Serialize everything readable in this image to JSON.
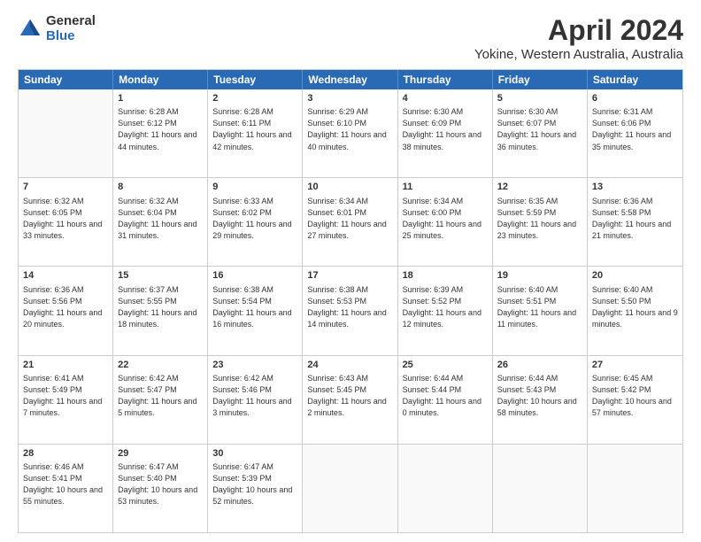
{
  "logo": {
    "general": "General",
    "blue": "Blue"
  },
  "title": "April 2024",
  "subtitle": "Yokine, Western Australia, Australia",
  "calendar": {
    "headers": [
      "Sunday",
      "Monday",
      "Tuesday",
      "Wednesday",
      "Thursday",
      "Friday",
      "Saturday"
    ],
    "weeks": [
      [
        {
          "day": "",
          "sunrise": "",
          "sunset": "",
          "daylight": "",
          "empty": true
        },
        {
          "day": "1",
          "sunrise": "Sunrise: 6:28 AM",
          "sunset": "Sunset: 6:12 PM",
          "daylight": "Daylight: 11 hours and 44 minutes."
        },
        {
          "day": "2",
          "sunrise": "Sunrise: 6:28 AM",
          "sunset": "Sunset: 6:11 PM",
          "daylight": "Daylight: 11 hours and 42 minutes."
        },
        {
          "day": "3",
          "sunrise": "Sunrise: 6:29 AM",
          "sunset": "Sunset: 6:10 PM",
          "daylight": "Daylight: 11 hours and 40 minutes."
        },
        {
          "day": "4",
          "sunrise": "Sunrise: 6:30 AM",
          "sunset": "Sunset: 6:09 PM",
          "daylight": "Daylight: 11 hours and 38 minutes."
        },
        {
          "day": "5",
          "sunrise": "Sunrise: 6:30 AM",
          "sunset": "Sunset: 6:07 PM",
          "daylight": "Daylight: 11 hours and 36 minutes."
        },
        {
          "day": "6",
          "sunrise": "Sunrise: 6:31 AM",
          "sunset": "Sunset: 6:06 PM",
          "daylight": "Daylight: 11 hours and 35 minutes."
        }
      ],
      [
        {
          "day": "7",
          "sunrise": "Sunrise: 6:32 AM",
          "sunset": "Sunset: 6:05 PM",
          "daylight": "Daylight: 11 hours and 33 minutes."
        },
        {
          "day": "8",
          "sunrise": "Sunrise: 6:32 AM",
          "sunset": "Sunset: 6:04 PM",
          "daylight": "Daylight: 11 hours and 31 minutes."
        },
        {
          "day": "9",
          "sunrise": "Sunrise: 6:33 AM",
          "sunset": "Sunset: 6:02 PM",
          "daylight": "Daylight: 11 hours and 29 minutes."
        },
        {
          "day": "10",
          "sunrise": "Sunrise: 6:34 AM",
          "sunset": "Sunset: 6:01 PM",
          "daylight": "Daylight: 11 hours and 27 minutes."
        },
        {
          "day": "11",
          "sunrise": "Sunrise: 6:34 AM",
          "sunset": "Sunset: 6:00 PM",
          "daylight": "Daylight: 11 hours and 25 minutes."
        },
        {
          "day": "12",
          "sunrise": "Sunrise: 6:35 AM",
          "sunset": "Sunset: 5:59 PM",
          "daylight": "Daylight: 11 hours and 23 minutes."
        },
        {
          "day": "13",
          "sunrise": "Sunrise: 6:36 AM",
          "sunset": "Sunset: 5:58 PM",
          "daylight": "Daylight: 11 hours and 21 minutes."
        }
      ],
      [
        {
          "day": "14",
          "sunrise": "Sunrise: 6:36 AM",
          "sunset": "Sunset: 5:56 PM",
          "daylight": "Daylight: 11 hours and 20 minutes."
        },
        {
          "day": "15",
          "sunrise": "Sunrise: 6:37 AM",
          "sunset": "Sunset: 5:55 PM",
          "daylight": "Daylight: 11 hours and 18 minutes."
        },
        {
          "day": "16",
          "sunrise": "Sunrise: 6:38 AM",
          "sunset": "Sunset: 5:54 PM",
          "daylight": "Daylight: 11 hours and 16 minutes."
        },
        {
          "day": "17",
          "sunrise": "Sunrise: 6:38 AM",
          "sunset": "Sunset: 5:53 PM",
          "daylight": "Daylight: 11 hours and 14 minutes."
        },
        {
          "day": "18",
          "sunrise": "Sunrise: 6:39 AM",
          "sunset": "Sunset: 5:52 PM",
          "daylight": "Daylight: 11 hours and 12 minutes."
        },
        {
          "day": "19",
          "sunrise": "Sunrise: 6:40 AM",
          "sunset": "Sunset: 5:51 PM",
          "daylight": "Daylight: 11 hours and 11 minutes."
        },
        {
          "day": "20",
          "sunrise": "Sunrise: 6:40 AM",
          "sunset": "Sunset: 5:50 PM",
          "daylight": "Daylight: 11 hours and 9 minutes."
        }
      ],
      [
        {
          "day": "21",
          "sunrise": "Sunrise: 6:41 AM",
          "sunset": "Sunset: 5:49 PM",
          "daylight": "Daylight: 11 hours and 7 minutes."
        },
        {
          "day": "22",
          "sunrise": "Sunrise: 6:42 AM",
          "sunset": "Sunset: 5:47 PM",
          "daylight": "Daylight: 11 hours and 5 minutes."
        },
        {
          "day": "23",
          "sunrise": "Sunrise: 6:42 AM",
          "sunset": "Sunset: 5:46 PM",
          "daylight": "Daylight: 11 hours and 3 minutes."
        },
        {
          "day": "24",
          "sunrise": "Sunrise: 6:43 AM",
          "sunset": "Sunset: 5:45 PM",
          "daylight": "Daylight: 11 hours and 2 minutes."
        },
        {
          "day": "25",
          "sunrise": "Sunrise: 6:44 AM",
          "sunset": "Sunset: 5:44 PM",
          "daylight": "Daylight: 11 hours and 0 minutes."
        },
        {
          "day": "26",
          "sunrise": "Sunrise: 6:44 AM",
          "sunset": "Sunset: 5:43 PM",
          "daylight": "Daylight: 10 hours and 58 minutes."
        },
        {
          "day": "27",
          "sunrise": "Sunrise: 6:45 AM",
          "sunset": "Sunset: 5:42 PM",
          "daylight": "Daylight: 10 hours and 57 minutes."
        }
      ],
      [
        {
          "day": "28",
          "sunrise": "Sunrise: 6:46 AM",
          "sunset": "Sunset: 5:41 PM",
          "daylight": "Daylight: 10 hours and 55 minutes."
        },
        {
          "day": "29",
          "sunrise": "Sunrise: 6:47 AM",
          "sunset": "Sunset: 5:40 PM",
          "daylight": "Daylight: 10 hours and 53 minutes."
        },
        {
          "day": "30",
          "sunrise": "Sunrise: 6:47 AM",
          "sunset": "Sunset: 5:39 PM",
          "daylight": "Daylight: 10 hours and 52 minutes."
        },
        {
          "day": "",
          "sunrise": "",
          "sunset": "",
          "daylight": "",
          "empty": true
        },
        {
          "day": "",
          "sunrise": "",
          "sunset": "",
          "daylight": "",
          "empty": true
        },
        {
          "day": "",
          "sunrise": "",
          "sunset": "",
          "daylight": "",
          "empty": true
        },
        {
          "day": "",
          "sunrise": "",
          "sunset": "",
          "daylight": "",
          "empty": true
        }
      ]
    ]
  }
}
